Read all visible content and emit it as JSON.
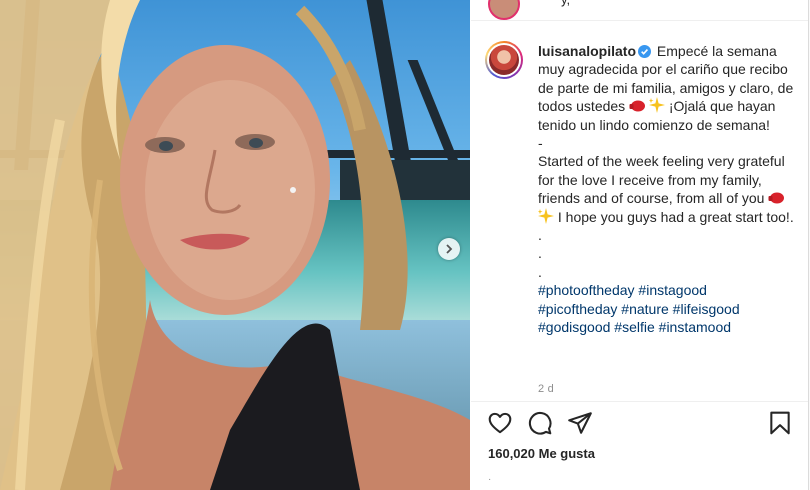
{
  "post": {
    "username": "luisanalopilato",
    "caption_es": "Empecé la semana muy agradecida por el cariño que recibo de parte de mi familia, amigos y claro, de todos ustedes",
    "caption_es_2": "¡Ojalá que hayan tenido un lindo comienzo de semana!",
    "separator": "-",
    "caption_en": "Started of the week feeling very grateful for the love I receive from my family, friends and of course, from all of you",
    "caption_en_2": "I hope you guys had a great start too!.",
    "dots": [
      ".",
      ".",
      "."
    ],
    "hashtags": [
      "#photooftheday",
      "#instagood",
      "#picoftheday",
      "#nature",
      "#lifeisgood",
      "#godisgood",
      "#selfie",
      "#instamood"
    ],
    "timestamp": "2 d",
    "likes_count": "160,020",
    "likes_label": "Me gusta"
  },
  "top_strip": {
    "partial_text": "y,"
  },
  "icons": {
    "verified": "verified-badge-icon",
    "like": "heart-icon",
    "comment": "comment-icon",
    "share": "paper-plane-icon",
    "save": "bookmark-icon",
    "next": "chevron-right-icon"
  },
  "colors": {
    "text": "#262626",
    "hashtag": "#00376b",
    "muted": "#8e8e8e",
    "verified": "#3897f0",
    "border": "#dbdbdb"
  }
}
